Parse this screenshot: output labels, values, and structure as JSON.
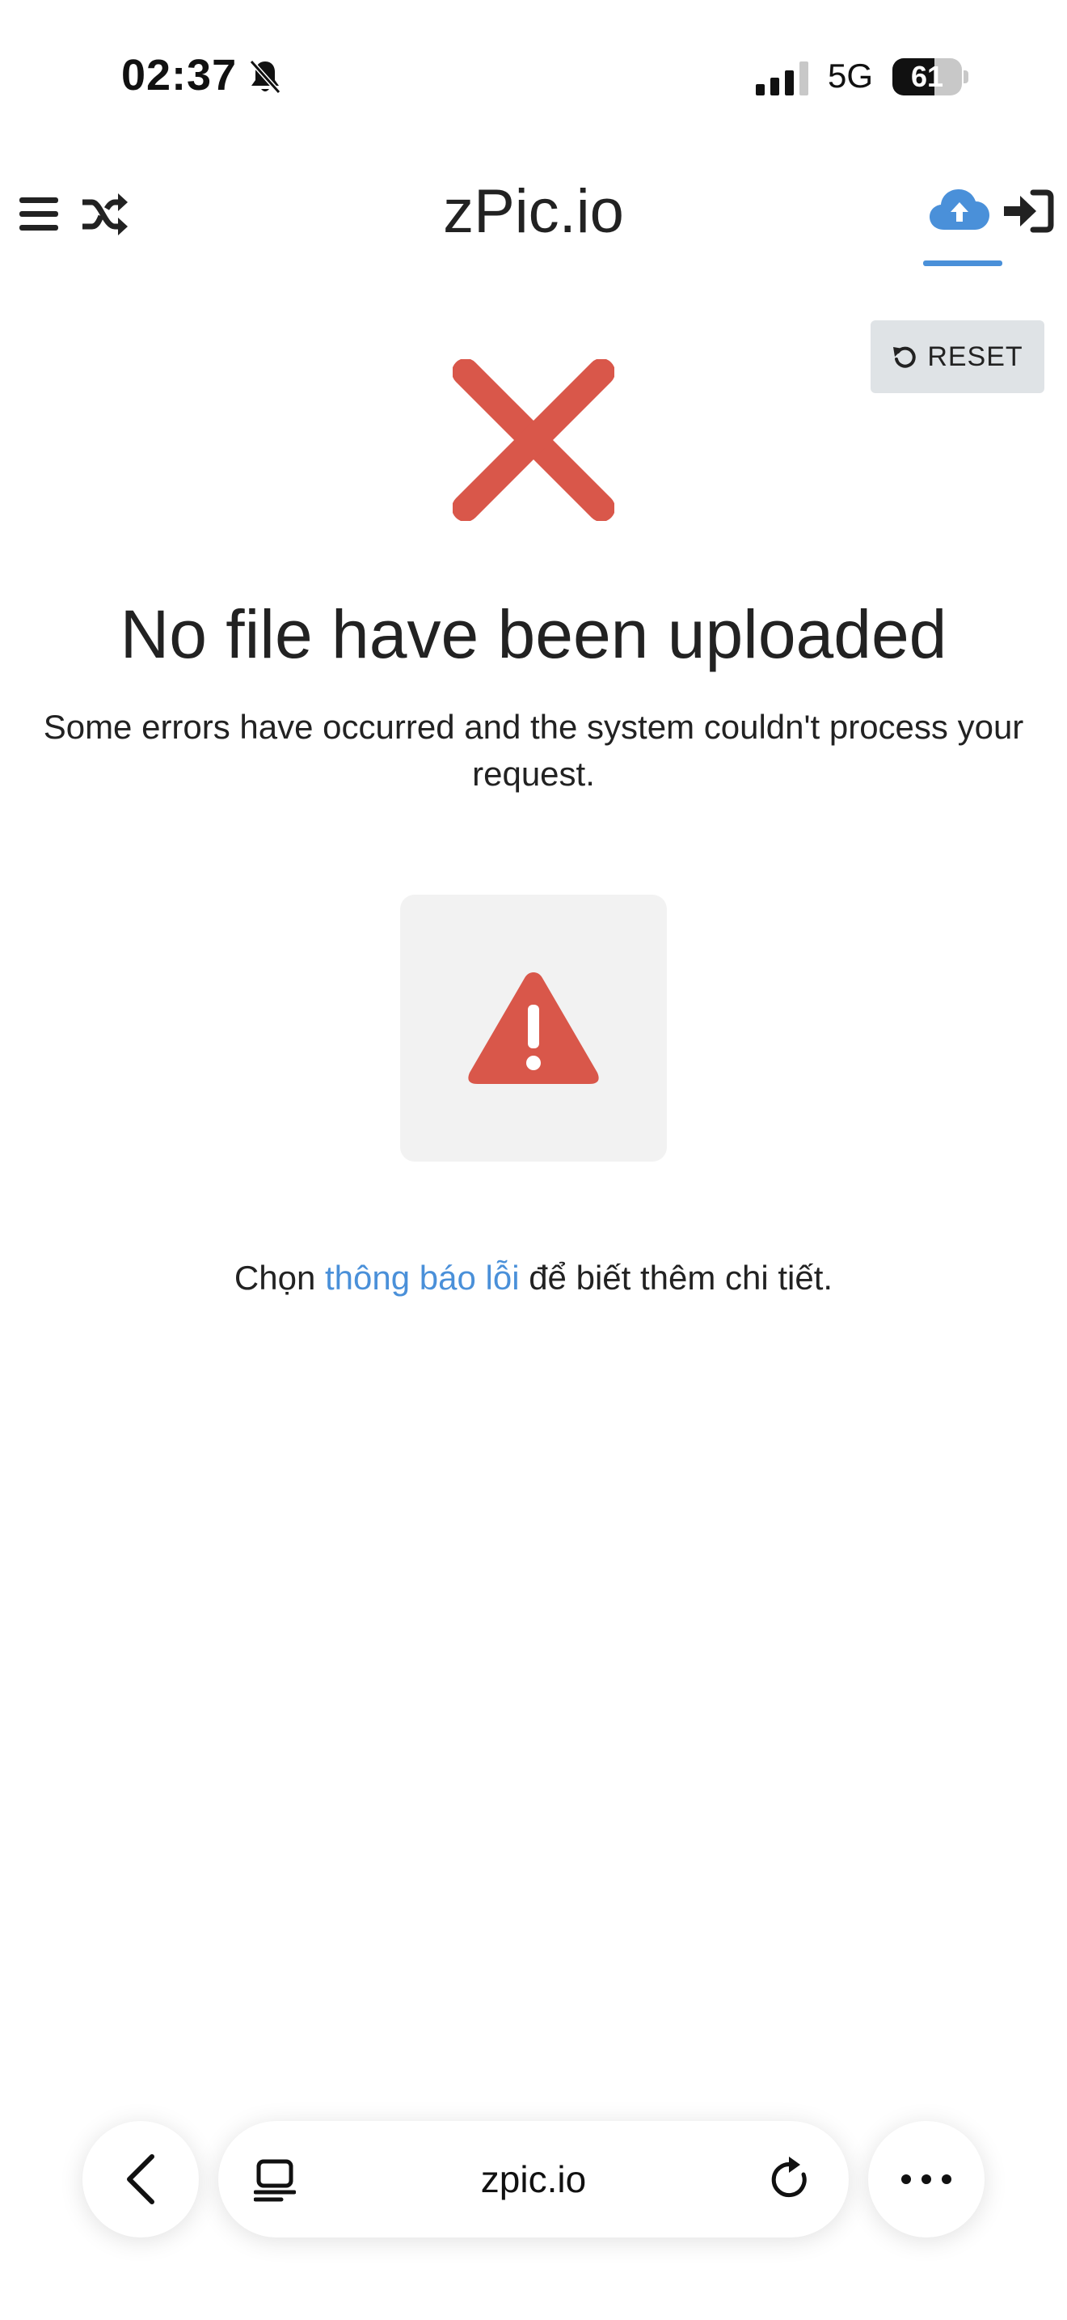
{
  "status_bar": {
    "time": "02:37",
    "network": "5G",
    "battery_level": "61",
    "battery_fraction": 0.61
  },
  "header": {
    "title": "zPic.io",
    "accent_color": "#4a90d9",
    "icons": [
      "menu-icon",
      "shuffle-icon",
      "upload-cloud-icon",
      "login-icon"
    ]
  },
  "toolbar": {
    "reset_label": "RESET"
  },
  "main": {
    "heading": "No file have been uploaded",
    "message": "Some errors have occurred and the system couldn't process your request.",
    "error_color": "#d9574a",
    "details_prefix": "Chọn ",
    "details_link": "thông báo lỗi",
    "details_suffix": " để biết thêm chi tiết."
  },
  "browser": {
    "address": "zpic.io"
  }
}
